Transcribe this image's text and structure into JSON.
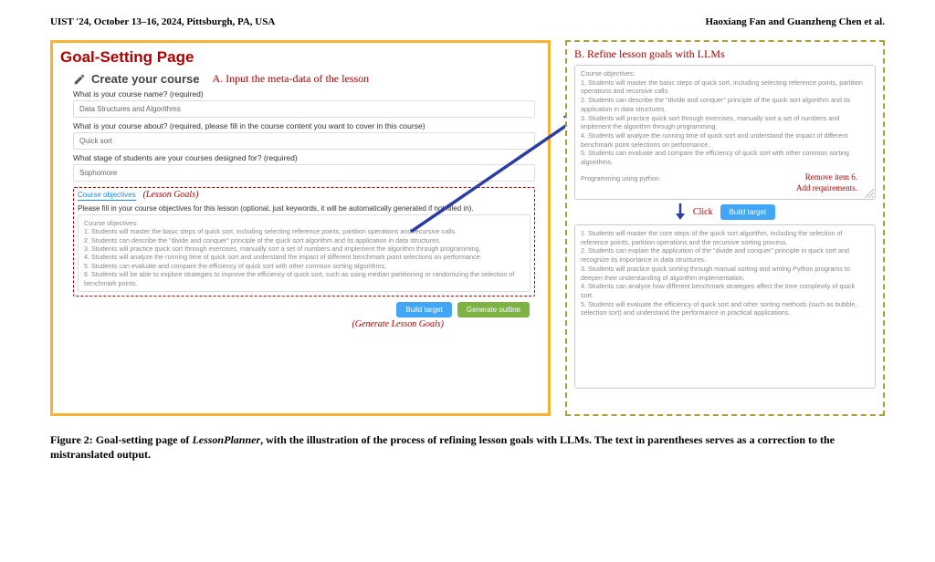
{
  "header": {
    "venue": "UIST '24, October 13–16, 2024, Pittsburgh, PA, USA",
    "authors": "Haoxiang Fan and Guanzheng Chen et al."
  },
  "panelA": {
    "pageTitle": "Goal-Setting Page",
    "createLabel": "Create your course",
    "sectionA": "A.   Input the meta-data of the lesson",
    "fields": {
      "nameLabel": "What is your course name? (required)",
      "nameValue": "Data Structures and Algorithms",
      "aboutLabel": "What is your course about? (required, please fill in the course content you want to cover in this course)",
      "aboutValue": "Quick sort",
      "stageLabel": "What stage of students are your courses designed for? (required)",
      "stageValue": "Sophomore"
    },
    "tabLabel": "Course objectives",
    "tabAnnot": "(Lesson Goals)",
    "objectivesPrompt": "Please fill in your course objectives for this lesson (optional, just keywords, it will be automatically generated if not filled in).",
    "objectivesHeader": "Course objectives:",
    "objectives": [
      "1. Students will master the basic steps of quick sort, including selecting reference points, partition operations and recursive calls.",
      "2. Students can describe the \"divide and conquer\" principle of the quick sort algorithm and its application in data structures.",
      "3. Students will practice quick sort through exercises, manually sort a set of numbers and implement the algorithm through programming.",
      "4. Students will analyze the running time of quick sort and understand the impact of different benchmark point selections on performance.",
      "5. Students can evaluate and compare the efficiency of quick sort with other common sorting algorithms.",
      "6. Students will be able to explore strategies to improve the efficiency of quick sort, such as using median partitioning or randomizing the selection of benchmark points."
    ],
    "buildBtn": "Build target",
    "generateBtn": "Generate outline",
    "btnAnnot": "(Generate Lesson Goals)"
  },
  "panelB": {
    "title": "B.   Refine lesson goals with LLMs",
    "box1Header": "Course objectives:",
    "box1": [
      "1. Students will master the basic steps of quick sort, including selecting reference points, partition operations and recursive calls.",
      "2. Students can describe the \"divide and conquer\" principle of the quick sort algorithm and its application in data structures.",
      "3. Students will practice quick sort through exercises, manually sort a set of numbers and implement the algorithm through programming.",
      "4. Students will analyze the running time of quick sort and understand the impact of different benchmark point selections on performance.",
      "5. Students can evaluate and compare the efficiency of quick sort with other common sorting algorithms."
    ],
    "box1Footer": "Programming using python.",
    "annotRemove": "Remove item 6.",
    "annotAdd": "Add requirements.",
    "clickLabel": "Click",
    "buildBtn2": "Build target",
    "box2": [
      "1. Students will master the core steps of the quick sort algorithm, including the selection of reference points, partition operations and the recursive sorting process.",
      "2. Students can explain the application of the \"divide and conquer\" principle in quick sort and recognize its importance in data structures.",
      "3. Students will practice quick sorting through manual sorting and writing Python programs to deepen their understanding of algorithm implementation.",
      "4. Students can analyze how different benchmark strategies affect the time complexity of quick sort.",
      "5. Students will evaluate the efficiency of quick sort and other sorting methods (such as bubble, selection sort) and understand the performance in practical applications."
    ]
  },
  "caption": {
    "prefix": "Figure 2: Goal-setting page of ",
    "appName": "LessonPlanner",
    "suffix": ", with the illustration of the process of refining lesson goals with LLMs. The text in parentheses serves as a correction to the mistranslated output."
  }
}
